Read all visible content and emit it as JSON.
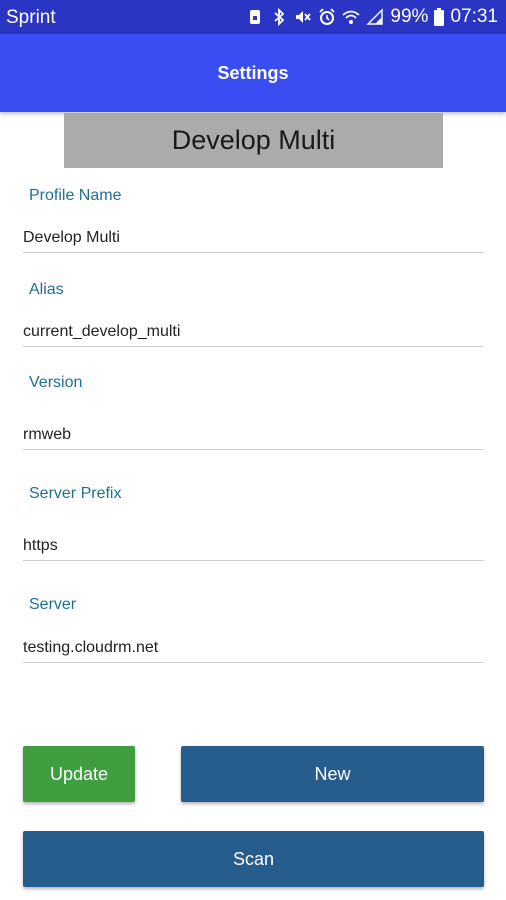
{
  "status_bar": {
    "carrier": "Sprint",
    "battery": "99%",
    "time": "07:31",
    "icons": [
      "sim-icon",
      "bluetooth-icon",
      "mute-icon",
      "alarm-icon",
      "wifi-icon",
      "signal-icon",
      "battery-icon"
    ]
  },
  "app_bar": {
    "title": "Settings"
  },
  "profile_banner": "Develop Multi",
  "fields": {
    "profile_name": {
      "label": "Profile Name",
      "value": "Develop Multi"
    },
    "alias": {
      "label": "Alias",
      "value": "current_develop_multi"
    },
    "version": {
      "label": "Version",
      "value": "rmweb"
    },
    "server_prefix": {
      "label": "Server Prefix",
      "value": "https"
    },
    "server": {
      "label": "Server",
      "value": "testing.cloudrm.net"
    }
  },
  "buttons": {
    "update": "Update",
    "new": "New",
    "scan": "Scan"
  },
  "colors": {
    "status_bar": "#2b35c4",
    "app_bar": "#3a4df3",
    "label": "#1e6f97",
    "update": "#3e9e40",
    "primary": "#275d8c",
    "banner": "#ababab"
  }
}
